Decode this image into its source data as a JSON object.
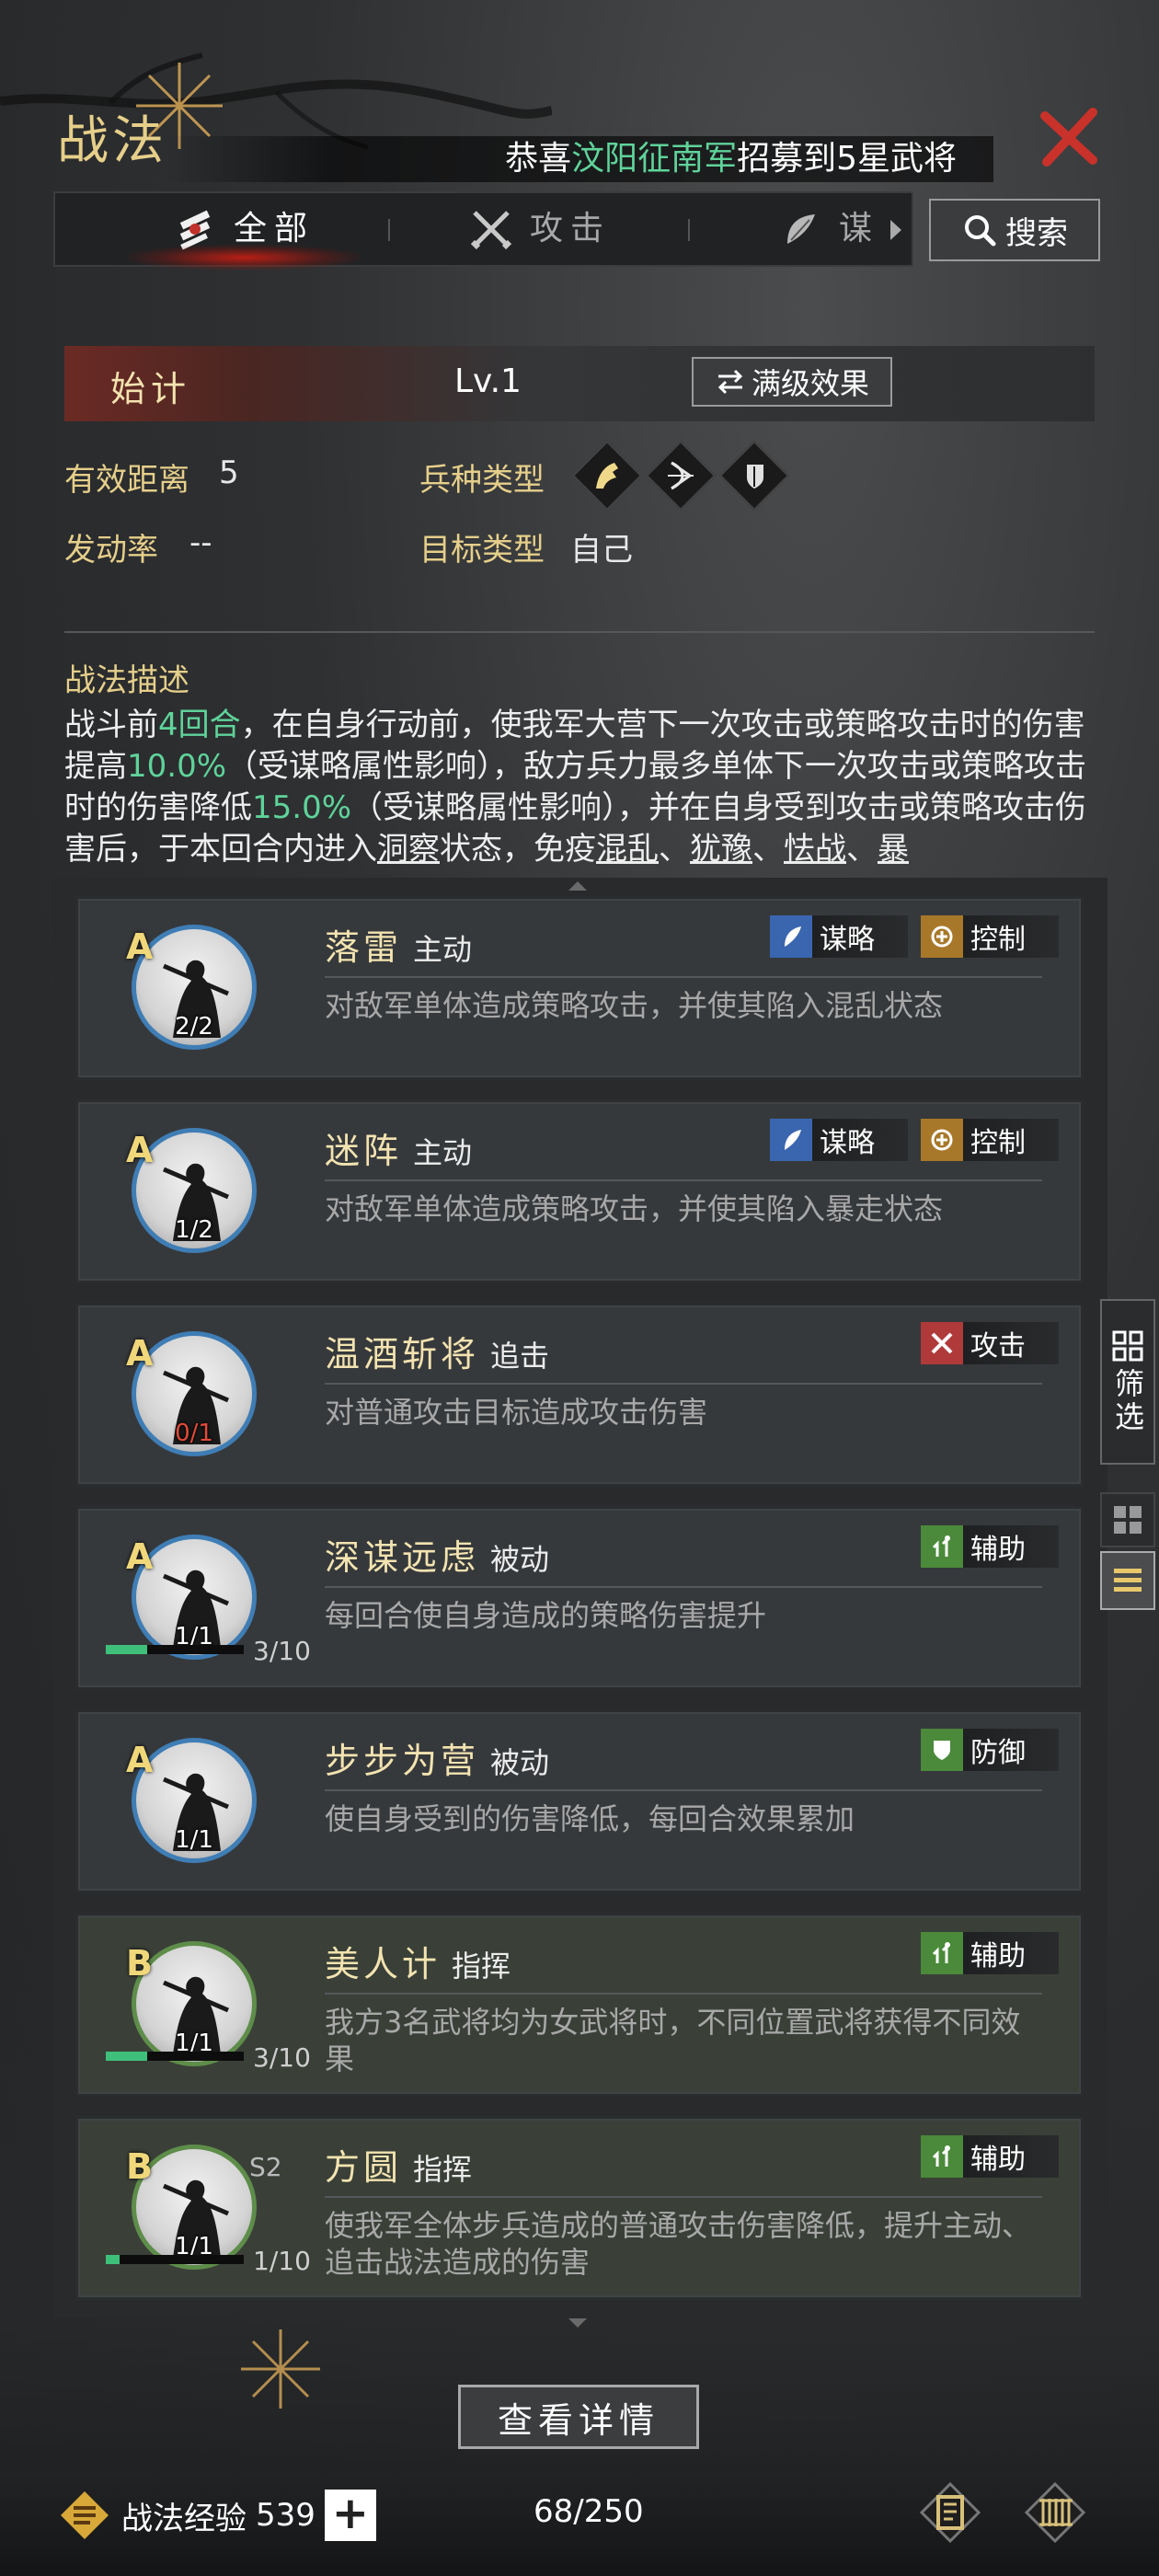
{
  "header": {
    "title": "战法",
    "notice": {
      "prefix": "恭喜",
      "highlight": "汶阳征南军",
      "suffix": "招募到5星武将"
    }
  },
  "tabs": [
    {
      "label": "全部",
      "active": true,
      "icon": "bundle-icon"
    },
    {
      "label": "攻击",
      "active": false,
      "icon": "crossed-swords-icon"
    },
    {
      "label": "谋",
      "active": false,
      "icon": "scroll-icon"
    }
  ],
  "search": {
    "label": "搜索"
  },
  "skill": {
    "name": "始计",
    "level": "Lv.1",
    "full_effect_label": "满级效果",
    "range_label": "有效距离",
    "range_value": "5",
    "troop_label": "兵种类型",
    "troop_icons": [
      "cavalry-icon",
      "archer-icon",
      "shield-icon"
    ],
    "rate_label": "发动率",
    "rate_value": "--",
    "target_label": "目标类型",
    "target_value": "自己",
    "desc_title": "战法描述",
    "desc": {
      "p1": "战斗前",
      "rounds": "4回合",
      "p2": "，在自身行动前，使我军大营下一次攻击或策略攻击时的伤害提高",
      "v1": "10.0%",
      "p3": "（受谋略属性影响），敌方兵力最多单体下一次攻击或策略攻击时的伤害降低",
      "v2": "15.0%",
      "p4": "（受谋略属性影响），并在自身受到攻击或策略攻击伤害后，于本回合内进入",
      "s1": "洞察",
      "p5": "状态，免疫",
      "s2": "混乱",
      "sep1": "、",
      "s3": "犹豫",
      "sep2": "、",
      "s4": "怯战",
      "sep3": "、",
      "s5": "暴"
    }
  },
  "tactics": [
    {
      "grade": "A",
      "name": "落雷",
      "type": "主动",
      "desc": "对敌军单体造成策略攻击，并使其陷入混乱状态",
      "count": "2/2",
      "tags": [
        {
          "label": "谋略",
          "icon": "strategy-icon",
          "color": "#3a66b0"
        },
        {
          "label": "控制",
          "icon": "control-icon",
          "color": "#a8782a"
        }
      ]
    },
    {
      "grade": "A",
      "name": "迷阵",
      "type": "主动",
      "desc": "对敌军单体造成策略攻击，并使其陷入暴走状态",
      "count": "1/2",
      "tags": [
        {
          "label": "谋略",
          "icon": "strategy-icon",
          "color": "#3a66b0"
        },
        {
          "label": "控制",
          "icon": "control-icon",
          "color": "#a8782a"
        }
      ]
    },
    {
      "grade": "A",
      "name": "温酒斩将",
      "type": "追击",
      "desc": "对普通攻击目标造成攻击伤害",
      "count": "0/1",
      "count_red": true,
      "tags": [
        {
          "label": "攻击",
          "icon": "attack-icon",
          "color": "#b03a3a"
        }
      ]
    },
    {
      "grade": "A",
      "name": "深谋远虑",
      "type": "被动",
      "desc": "每回合使自身造成的策略伤害提升",
      "count": "1/1",
      "progress_text": "3/10",
      "progress": 0.3,
      "tags": [
        {
          "label": "辅助",
          "icon": "support-icon",
          "color": "#4a8a3a"
        }
      ]
    },
    {
      "grade": "A",
      "name": "步步为营",
      "type": "被动",
      "desc": "使自身受到的伤害降低，每回合效果累加",
      "count": "1/1",
      "tags": [
        {
          "label": "防御",
          "icon": "defense-icon",
          "color": "#4a8a3a"
        }
      ]
    },
    {
      "grade": "B",
      "name": "美人计",
      "type": "指挥",
      "desc": "我方3名武将均为女武将时，不同位置武将获得不同效果",
      "count": "1/1",
      "progress_text": "3/10",
      "progress": 0.3,
      "tags": [
        {
          "label": "辅助",
          "icon": "support-icon",
          "color": "#4a8a3a"
        }
      ]
    },
    {
      "grade": "B",
      "name": "方圆",
      "type": "指挥",
      "season": "S2",
      "desc": "使我军全体步兵造成的普通攻击伤害降低，提升主动、追击战法造成的伤害",
      "count": "1/1",
      "progress_text": "1/10",
      "progress": 0.1,
      "tags": [
        {
          "label": "辅助",
          "icon": "support-icon",
          "color": "#4a8a3a"
        }
      ]
    }
  ],
  "side": {
    "filter_label": "筛选"
  },
  "footer": {
    "detail_label": "查看详情",
    "exp_label": "战法经验",
    "exp_value": "539",
    "plus_label": "+",
    "capacity": "68/250"
  }
}
